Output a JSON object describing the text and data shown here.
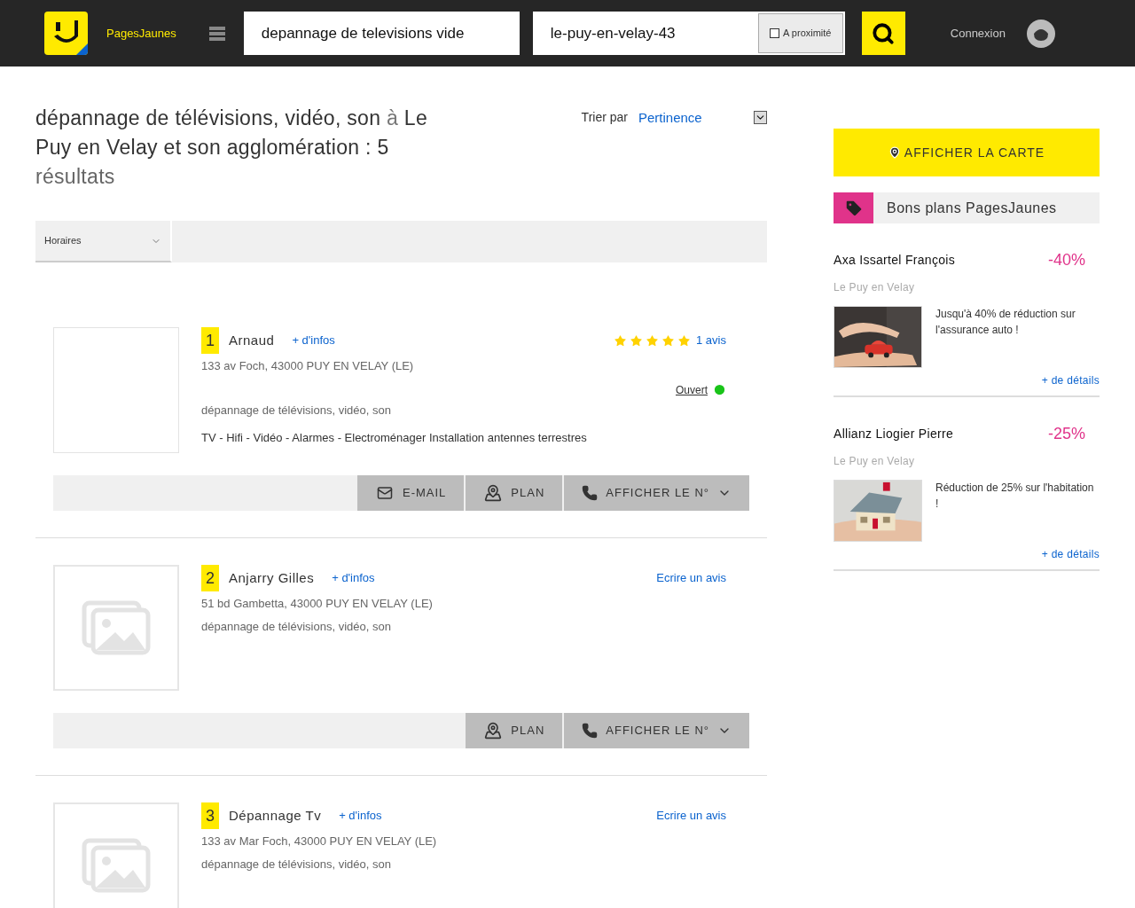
{
  "header": {
    "brand": "PagesJaunes",
    "search": {
      "value": "depannage de televisions vide"
    },
    "location": {
      "value": "le-puy-en-velay-43"
    },
    "nearby": {
      "label": "A proximité",
      "checked": false
    },
    "login": "Connexion"
  },
  "results_header": {
    "query": "dépannage de télévisions, vidéo, son",
    "preposition": "à",
    "place": "Le Puy en Velay et son agglomération :",
    "count": "5",
    "count_label": "résultats",
    "sort_label": "Trier par",
    "sort_value": "Pertinence"
  },
  "filters": [
    {
      "label": "Horaires"
    }
  ],
  "results": [
    {
      "number": "1",
      "name": "Arnaud",
      "more": "+ d'infos",
      "address": "133 av Foch, 43000 PUY EN VELAY (LE)",
      "thumbnail": {
        "kind": "empty"
      },
      "stars": 5,
      "reviews": "1 avis",
      "status": {
        "label": "Ouvert",
        "open": true
      },
      "category": "dépannage de télévisions, vidéo, son",
      "description": "TV - Hifi - Vidéo - Alarmes - Electroménager Installation antennes terrestres",
      "actions": [
        {
          "kind": "email",
          "label": "E-MAIL"
        },
        {
          "kind": "plan",
          "label": "PLAN"
        },
        {
          "kind": "phone",
          "label": "AFFICHER LE N°"
        }
      ]
    },
    {
      "number": "2",
      "name": "Anjarry Gilles",
      "more": "+ d'infos",
      "address": "51 bd Gambetta, 43000 PUY EN VELAY (LE)",
      "thumbnail": {
        "kind": "placeholder"
      },
      "write_review": "Ecrire un avis",
      "category": "dépannage de télévisions, vidéo, son",
      "actions": [
        {
          "kind": "plan",
          "label": "PLAN"
        },
        {
          "kind": "phone",
          "label": "AFFICHER LE N°"
        }
      ]
    },
    {
      "number": "3",
      "name": "Dépannage Tv",
      "more": "+ d'infos",
      "address": "133 av Mar Foch, 43000 PUY EN VELAY (LE)",
      "thumbnail": {
        "kind": "placeholder"
      },
      "write_review": "Ecrire un avis",
      "category": "dépannage de télévisions, vidéo, son"
    }
  ],
  "sidebar": {
    "map_button": "AFFICHER LA CARTE",
    "deals_title": "Bons plans PagesJaunes",
    "deals": [
      {
        "name": "Axa Issartel François",
        "discount": "-40%",
        "city": "Le Puy en Velay",
        "text": "Jusqu'à 40% de réduction sur l'assurance auto !",
        "link": "+ de détails"
      },
      {
        "name": "Allianz Liogier Pierre",
        "discount": "-25%",
        "city": "Le Puy en Velay",
        "text": "Réduction de 25% sur l'habitation !",
        "link": "+ de détails"
      }
    ]
  }
}
